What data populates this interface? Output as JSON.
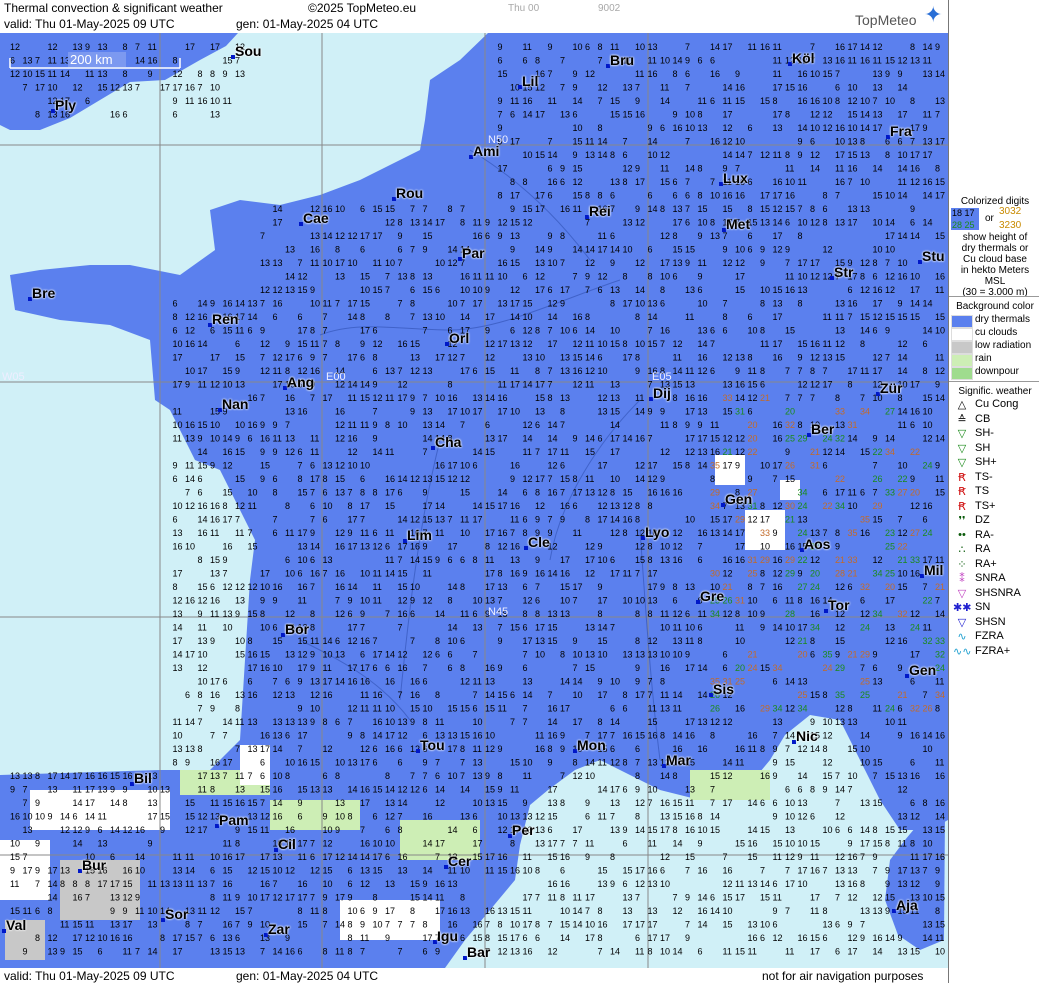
{
  "header": {
    "title": "Thermal convection & significant weather",
    "copyright": "©2025 TopMeteo.eu",
    "day_label": "Thu 00",
    "code": "9002",
    "valid_text": "valid:  Thu  01-May-2025  09 UTC",
    "gen_text": "gen: 01-May-2025 04 UTC",
    "logo_text": "TopMeteo"
  },
  "footer": {
    "valid_text": "valid:  Thu  01-May-2025  09 UTC",
    "gen_text": "gen: 01-May-2025 04 UTC",
    "disclaimer": "not for air navigation purposes"
  },
  "map": {
    "scale_label": "200 km",
    "graticule_labels": [
      "N50",
      "W05",
      "E00",
      "E05",
      "N45"
    ],
    "cities": [
      {
        "name": "Sou"
      },
      {
        "name": "Ply"
      },
      {
        "name": "Lil"
      },
      {
        "name": "Bru"
      },
      {
        "name": "Köl"
      },
      {
        "name": "Ami"
      },
      {
        "name": "Fra"
      },
      {
        "name": "Rou"
      },
      {
        "name": "Lux"
      },
      {
        "name": "Cae"
      },
      {
        "name": "Rei"
      },
      {
        "name": "Met"
      },
      {
        "name": "Par"
      },
      {
        "name": "Stu"
      },
      {
        "name": "Bre"
      },
      {
        "name": "Str"
      },
      {
        "name": "Ren"
      },
      {
        "name": "Orl"
      },
      {
        "name": "Ang"
      },
      {
        "name": "Dij"
      },
      {
        "name": "Zür"
      },
      {
        "name": "Nan"
      },
      {
        "name": "Ber"
      },
      {
        "name": "Cha"
      },
      {
        "name": "Gen"
      },
      {
        "name": "Lim"
      },
      {
        "name": "Cle"
      },
      {
        "name": "Lyo"
      },
      {
        "name": "Aos"
      },
      {
        "name": "Mil"
      },
      {
        "name": "Gre"
      },
      {
        "name": "Tor"
      },
      {
        "name": "Bor"
      },
      {
        "name": "Gen"
      },
      {
        "name": "Sis"
      },
      {
        "name": "Tou"
      },
      {
        "name": "Mon"
      },
      {
        "name": "Nic"
      },
      {
        "name": "Mar"
      },
      {
        "name": "Bil"
      },
      {
        "name": "Per"
      },
      {
        "name": "Pam"
      },
      {
        "name": "Cil"
      },
      {
        "name": "Bur"
      },
      {
        "name": "Cer"
      },
      {
        "name": "Sor"
      },
      {
        "name": "Aja"
      },
      {
        "name": "Val"
      },
      {
        "name": "Zar"
      },
      {
        "name": "Igu"
      },
      {
        "name": "Bar"
      }
    ],
    "colors": {
      "sea": "#d0f0f7",
      "dry_thermals": "#5b80ee",
      "cu_clouds": "#ffffff",
      "low_radiation": "#c8c8c8",
      "rain": "#cdeeb5",
      "downpour": "#9fdc8e"
    }
  },
  "legend": {
    "digits_title": "Colorized digits",
    "digits_example_a": "18  17",
    "digits_example_b": "28 25",
    "digits_or": "or",
    "digits_example_c": "3032",
    "digits_example_d": "3230",
    "digits_desc": [
      "show height of",
      "dry thermals or",
      "Cu cloud base",
      "in hekto Meters",
      "MSL",
      "(30 = 3.000 m)"
    ],
    "bg_title": "Background color",
    "bg_items": [
      {
        "label": "dry thermals",
        "color": "#5b80ee"
      },
      {
        "label": "cu clouds",
        "color": "#ffffff"
      },
      {
        "label": "low radiation",
        "color": "#c8c8c8"
      },
      {
        "label": "rain",
        "color": "#cdeeb5"
      },
      {
        "label": "downpour",
        "color": "#9fdc8e"
      }
    ],
    "wx_title": "Signific. weather",
    "wx_items": [
      {
        "label": "Cu Cong",
        "icon": "cu-cong-icon",
        "glyph": "△",
        "color": "#000"
      },
      {
        "label": "CB",
        "icon": "cb-icon",
        "glyph": "≙",
        "color": "#000"
      },
      {
        "label": "SH-",
        "icon": "shower-light-icon",
        "glyph": "▽",
        "color": "#1a8a1a"
      },
      {
        "label": "SH",
        "icon": "shower-icon",
        "glyph": "▽",
        "color": "#1a8a1a"
      },
      {
        "label": "SH+",
        "icon": "shower-heavy-icon",
        "glyph": "▽",
        "color": "#1a8a1a"
      },
      {
        "label": "TS-",
        "icon": "thunderstorm-light-icon",
        "glyph": "Ꞧ",
        "color": "#d01010"
      },
      {
        "label": "TS",
        "icon": "thunderstorm-icon",
        "glyph": "Ꞧ",
        "color": "#d01010"
      },
      {
        "label": "TS+",
        "icon": "thunderstorm-heavy-icon",
        "glyph": "Ꞧ",
        "color": "#d01010"
      },
      {
        "label": "DZ",
        "icon": "drizzle-icon",
        "glyph": "❜❜",
        "color": "#0a5a0a"
      },
      {
        "label": "RA-",
        "icon": "rain-light-icon",
        "glyph": "••",
        "color": "#0a5a0a"
      },
      {
        "label": "RA",
        "icon": "rain-icon",
        "glyph": "∴",
        "color": "#0a5a0a"
      },
      {
        "label": "RA+",
        "icon": "rain-heavy-icon",
        "glyph": "⁘",
        "color": "#0a5a0a"
      },
      {
        "label": "SNRA",
        "icon": "snow-rain-icon",
        "glyph": "⁑",
        "color": "#c040c0"
      },
      {
        "label": "SHSNRA",
        "icon": "snow-rain-shower-icon",
        "glyph": "▽",
        "color": "#c040c0"
      },
      {
        "label": "SN",
        "icon": "snow-icon",
        "glyph": "✱✱",
        "color": "#2020d0"
      },
      {
        "label": "SHSN",
        "icon": "snow-shower-icon",
        "glyph": "▽",
        "color": "#2020d0"
      },
      {
        "label": "FZRA",
        "icon": "freezing-rain-icon",
        "glyph": "∿",
        "color": "#20a0d0"
      },
      {
        "label": "FZRA+",
        "icon": "freezing-rain-heavy-icon",
        "glyph": "∿∿",
        "color": "#20a0d0"
      }
    ]
  }
}
